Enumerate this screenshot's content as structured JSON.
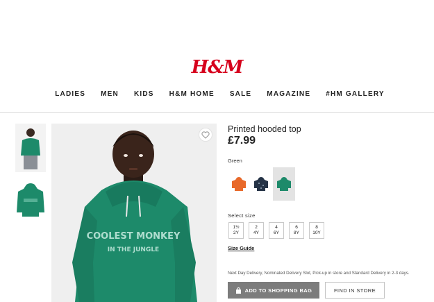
{
  "brand": {
    "logo": "H&M"
  },
  "nav": {
    "items": [
      "LADIES",
      "MEN",
      "KIDS",
      "H&M HOME",
      "SALE",
      "MAGAZINE",
      "#HM GALLERY"
    ]
  },
  "product": {
    "name": "Printed hooded top",
    "price": "£7.99",
    "color_label": "Green",
    "hoodie_print": [
      "COOLEST MONKEY",
      "IN THE JUNGLE"
    ],
    "colors": [
      {
        "name": "orange",
        "hex": "#e8692a"
      },
      {
        "name": "navy",
        "hex": "#253346"
      },
      {
        "name": "green",
        "hex": "#1d8a6a",
        "selected": true
      }
    ],
    "size_label": "Select size",
    "sizes": [
      {
        "top": "1½",
        "bottom": "2Y"
      },
      {
        "top": "2",
        "bottom": "4Y"
      },
      {
        "top": "4",
        "bottom": "6Y"
      },
      {
        "top": "6",
        "bottom": "8Y"
      },
      {
        "top": "8",
        "bottom": "10Y"
      }
    ],
    "size_guide": "Size Guide",
    "delivery_text": "Next Day Delivery, Nominated Delivery Slot, Pick-up in store and Standard Delivery in 2-3 days.",
    "add_to_bag": "ADD TO SHOPPING BAG",
    "find_in_store": "FIND IN STORE"
  },
  "colors": {
    "brand_red": "#d6001c",
    "hoodie_green": "#1d8a6a"
  }
}
